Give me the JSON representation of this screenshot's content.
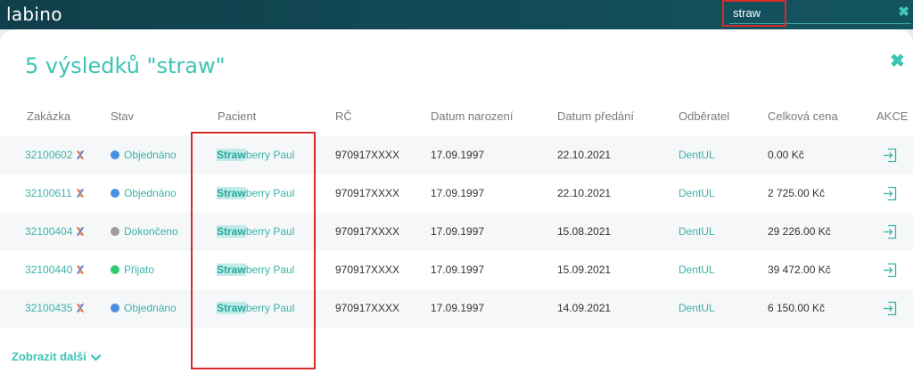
{
  "app": {
    "logo": "labino"
  },
  "search": {
    "value": "straw"
  },
  "panel": {
    "title": "5 výsledků \"straw\"",
    "more_label": "Zobrazit další"
  },
  "columns": [
    "Zakázka",
    "Stav",
    "Pacient",
    "RČ",
    "Datum narození",
    "Datum předání",
    "Odběratel",
    "Celková cena",
    "AKCE"
  ],
  "rows": [
    {
      "order": "32100602",
      "status": "Objednáno",
      "status_color": "#4a90e2",
      "patient_hl": "Straw",
      "patient_rest": "berry Paul",
      "rc": "970917XXXX",
      "birth": "17.09.1997",
      "handover": "22.10.2021",
      "customer": "DentUL",
      "price": "0.00 Kč"
    },
    {
      "order": "32100611",
      "status": "Objednáno",
      "status_color": "#4a90e2",
      "patient_hl": "Straw",
      "patient_rest": "berry Paul",
      "rc": "970917XXXX",
      "birth": "17.09.1997",
      "handover": "22.10.2021",
      "customer": "DentUL",
      "price": "2 725.00 Kč"
    },
    {
      "order": "32100404",
      "status": "Dokončeno",
      "status_color": "#9e9e9e",
      "patient_hl": "Straw",
      "patient_rest": "berry Paul",
      "rc": "970917XXXX",
      "birth": "17.09.1997",
      "handover": "15.08.2021",
      "customer": "DentUL",
      "price": "29 226.00 Kč"
    },
    {
      "order": "32100440",
      "status": "Přijato",
      "status_color": "#2ecc71",
      "patient_hl": "Straw",
      "patient_rest": "berry Paul",
      "rc": "970917XXXX",
      "birth": "17.09.1997",
      "handover": "15.09.2021",
      "customer": "DentUL",
      "price": "39 472.00 Kč"
    },
    {
      "order": "32100435",
      "status": "Objednáno",
      "status_color": "#4a90e2",
      "patient_hl": "Straw",
      "patient_rest": "berry Paul",
      "rc": "970917XXXX",
      "birth": "17.09.1997",
      "handover": "14.09.2021",
      "customer": "DentUL",
      "price": "6 150.00 Kč"
    }
  ],
  "icons": {
    "dna": "dna-icon",
    "action": "sign-in-icon",
    "close": "close-icon",
    "chevron": "chevron-down-icon"
  }
}
